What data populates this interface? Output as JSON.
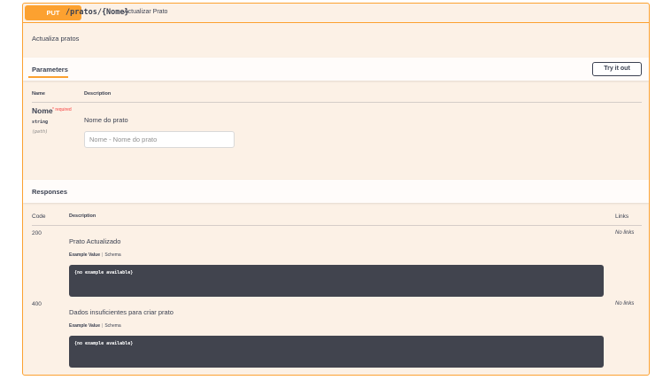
{
  "operation": {
    "method": "PUT",
    "path": "/pratos/{Nome}",
    "summary": "Actualizar Prato",
    "description": "Actualiza pratos"
  },
  "parameters": {
    "tab_label": "Parameters",
    "try_button": "Try it out",
    "columns": {
      "name": "Name",
      "description": "Description"
    },
    "items": [
      {
        "name": "Nome",
        "required": "* required",
        "type": "string",
        "in": "(path)",
        "description": "Nome do prato",
        "placeholder": "Nome - Nome do prato",
        "value": ""
      }
    ]
  },
  "responses": {
    "title": "Responses",
    "columns": {
      "code": "Code",
      "description": "Description",
      "links": "Links"
    },
    "items": [
      {
        "code": "200",
        "description": "Prato Actualizado",
        "example_value": "Example Value",
        "schema": "Schema",
        "example": "{no example available}",
        "links": "No links"
      },
      {
        "code": "400",
        "description": "Dados insuficientes para criar prato",
        "example_value": "Example Value",
        "schema": "Schema",
        "example": "{no example available}",
        "links": "No links"
      }
    ]
  },
  "colors": {
    "accent": "#fca130",
    "background": "#fcf1e6",
    "code_block": "#41444e",
    "required": "#f93e3e"
  }
}
